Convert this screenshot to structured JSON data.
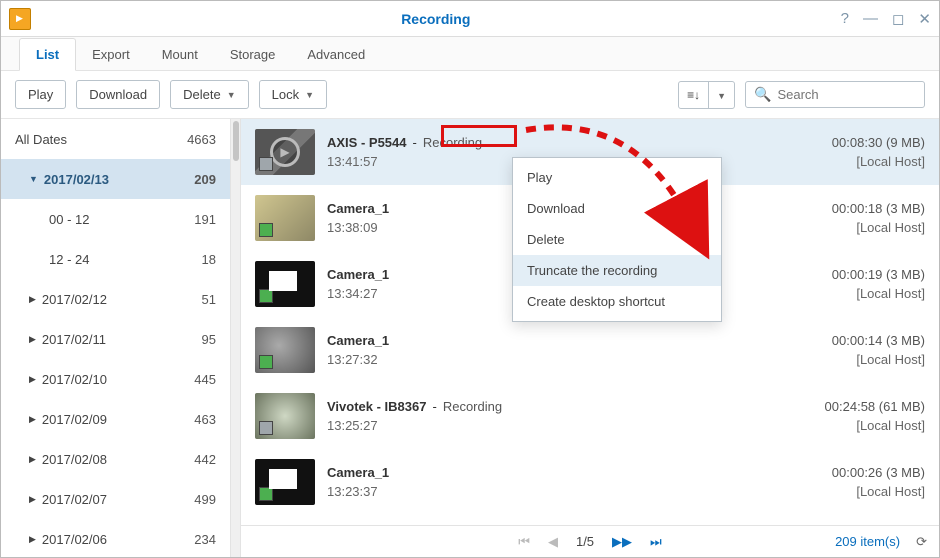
{
  "window": {
    "title": "Recording"
  },
  "tabs": [
    "List",
    "Export",
    "Mount",
    "Storage",
    "Advanced"
  ],
  "active_tab": 0,
  "toolbar": {
    "play": "Play",
    "download": "Download",
    "delete": "Delete",
    "lock": "Lock",
    "search_placeholder": "Search"
  },
  "sidebar": {
    "all": {
      "label": "All Dates",
      "count": 4663
    },
    "selected": {
      "label": "2017/02/13",
      "count": 209
    },
    "hours": [
      {
        "label": "00 - 12",
        "count": 191
      },
      {
        "label": "12 - 24",
        "count": 18
      }
    ],
    "dates": [
      {
        "label": "2017/02/12",
        "count": 51
      },
      {
        "label": "2017/02/11",
        "count": 95
      },
      {
        "label": "2017/02/10",
        "count": 445
      },
      {
        "label": "2017/02/09",
        "count": 463
      },
      {
        "label": "2017/02/08",
        "count": 442
      },
      {
        "label": "2017/02/07",
        "count": 499
      },
      {
        "label": "2017/02/06",
        "count": 234
      }
    ]
  },
  "items": [
    {
      "name": "AXIS - P5544",
      "status": "Recording",
      "time": "13:41:57",
      "dur": "00:08:30 (9 MB)",
      "host": "[Local Host]",
      "selected": true
    },
    {
      "name": "Camera_1",
      "status": "",
      "time": "13:38:09",
      "dur": "00:00:18 (3 MB)",
      "host": "[Local Host]"
    },
    {
      "name": "Camera_1",
      "status": "",
      "time": "13:34:27",
      "dur": "00:00:19 (3 MB)",
      "host": "[Local Host]"
    },
    {
      "name": "Camera_1",
      "status": "",
      "time": "13:27:32",
      "dur": "00:00:14 (3 MB)",
      "host": "[Local Host]"
    },
    {
      "name": "Vivotek - IB8367",
      "status": "Recording",
      "time": "13:25:27",
      "dur": "00:24:58 (61 MB)",
      "host": "[Local Host]"
    },
    {
      "name": "Camera_1",
      "status": "",
      "time": "13:23:37",
      "dur": "00:00:26 (3 MB)",
      "host": "[Local Host]"
    }
  ],
  "ctx": {
    "play": "Play",
    "download": "Download",
    "delete": "Delete",
    "truncate": "Truncate the recording",
    "shortcut": "Create desktop shortcut"
  },
  "pager": {
    "page": "1/5",
    "total": "209 item(s)"
  }
}
